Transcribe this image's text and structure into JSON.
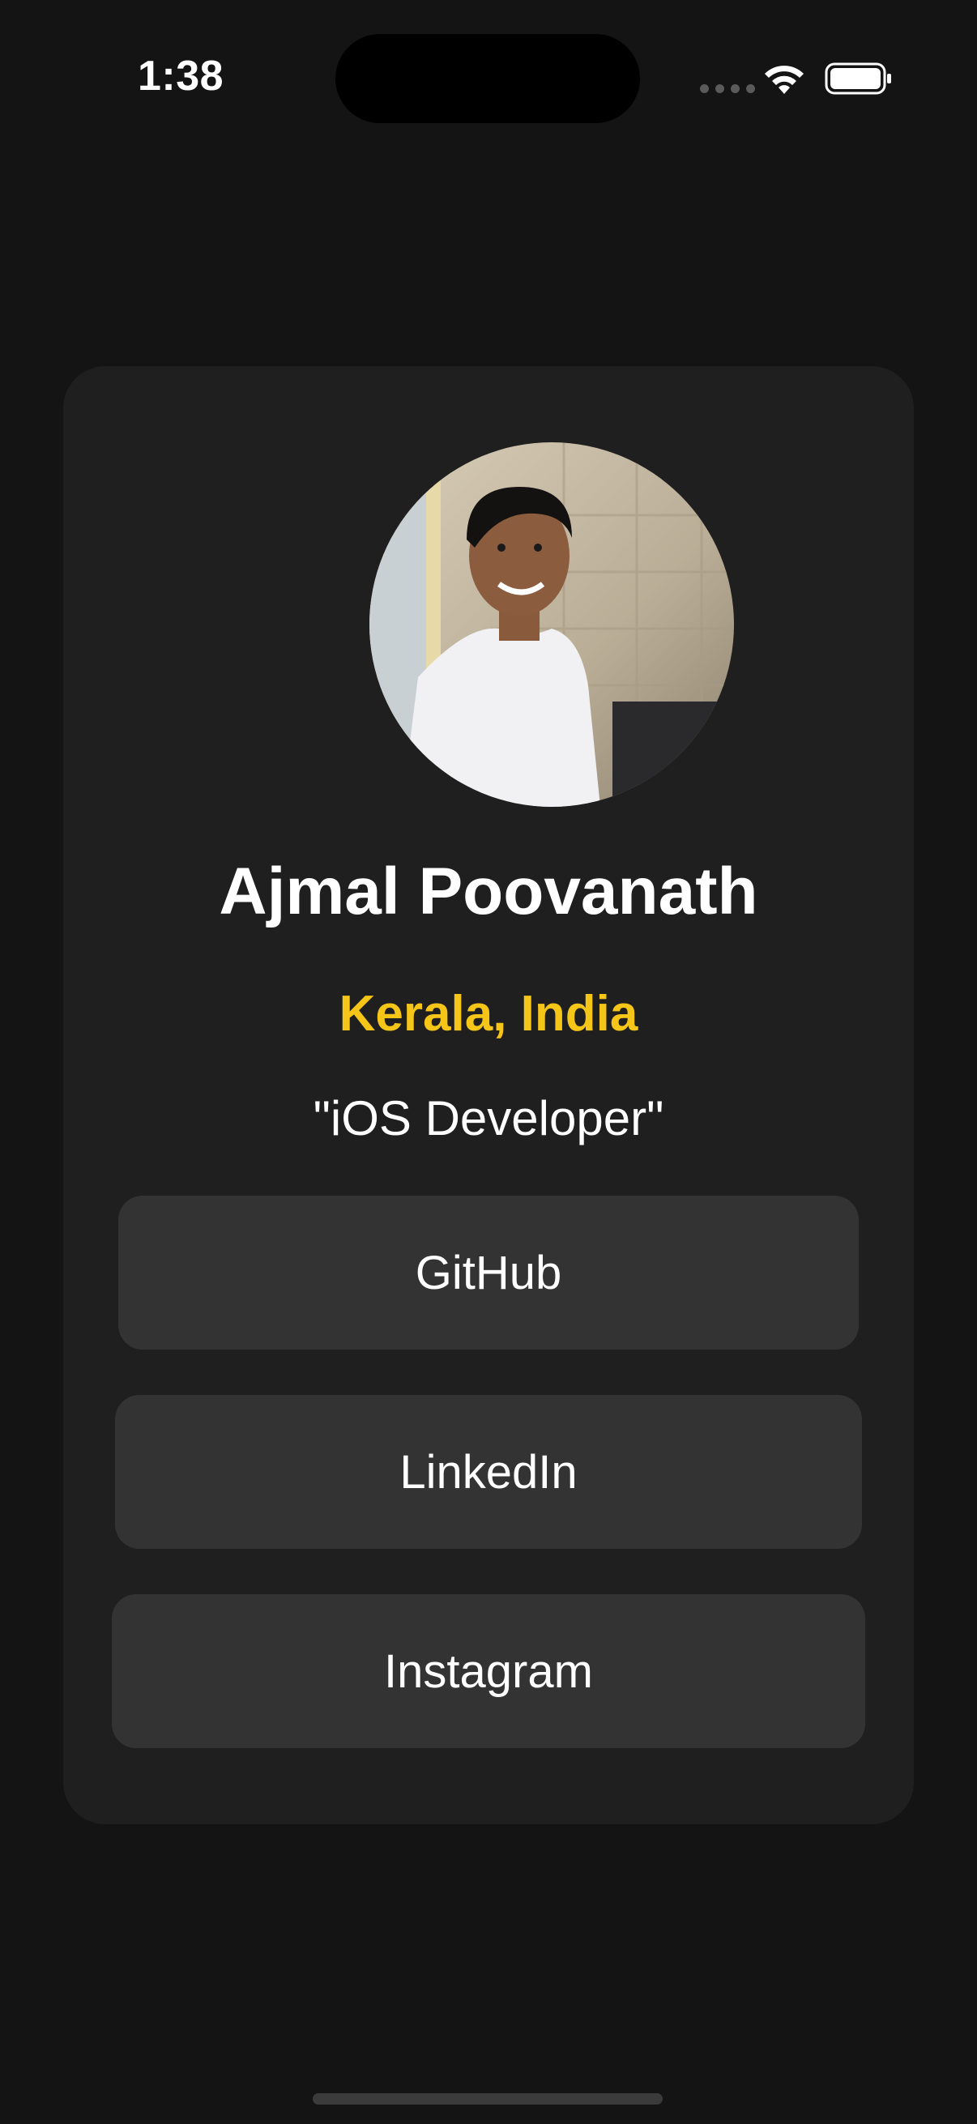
{
  "status_bar": {
    "time": "1:38",
    "wifi_icon": "wifi-icon",
    "battery_icon": "battery-icon"
  },
  "profile": {
    "name": "Ajmal Poovanath",
    "location": "Kerala, India",
    "role": "\"iOS Developer\"",
    "avatar": "profile-photo"
  },
  "links": [
    {
      "label": "GitHub"
    },
    {
      "label": "LinkedIn"
    },
    {
      "label": "Instagram"
    }
  ],
  "colors": {
    "background": "#141414",
    "card": "#1f1f1f",
    "button": "#333333",
    "accent": "#f5c518",
    "text": "#ffffff"
  }
}
